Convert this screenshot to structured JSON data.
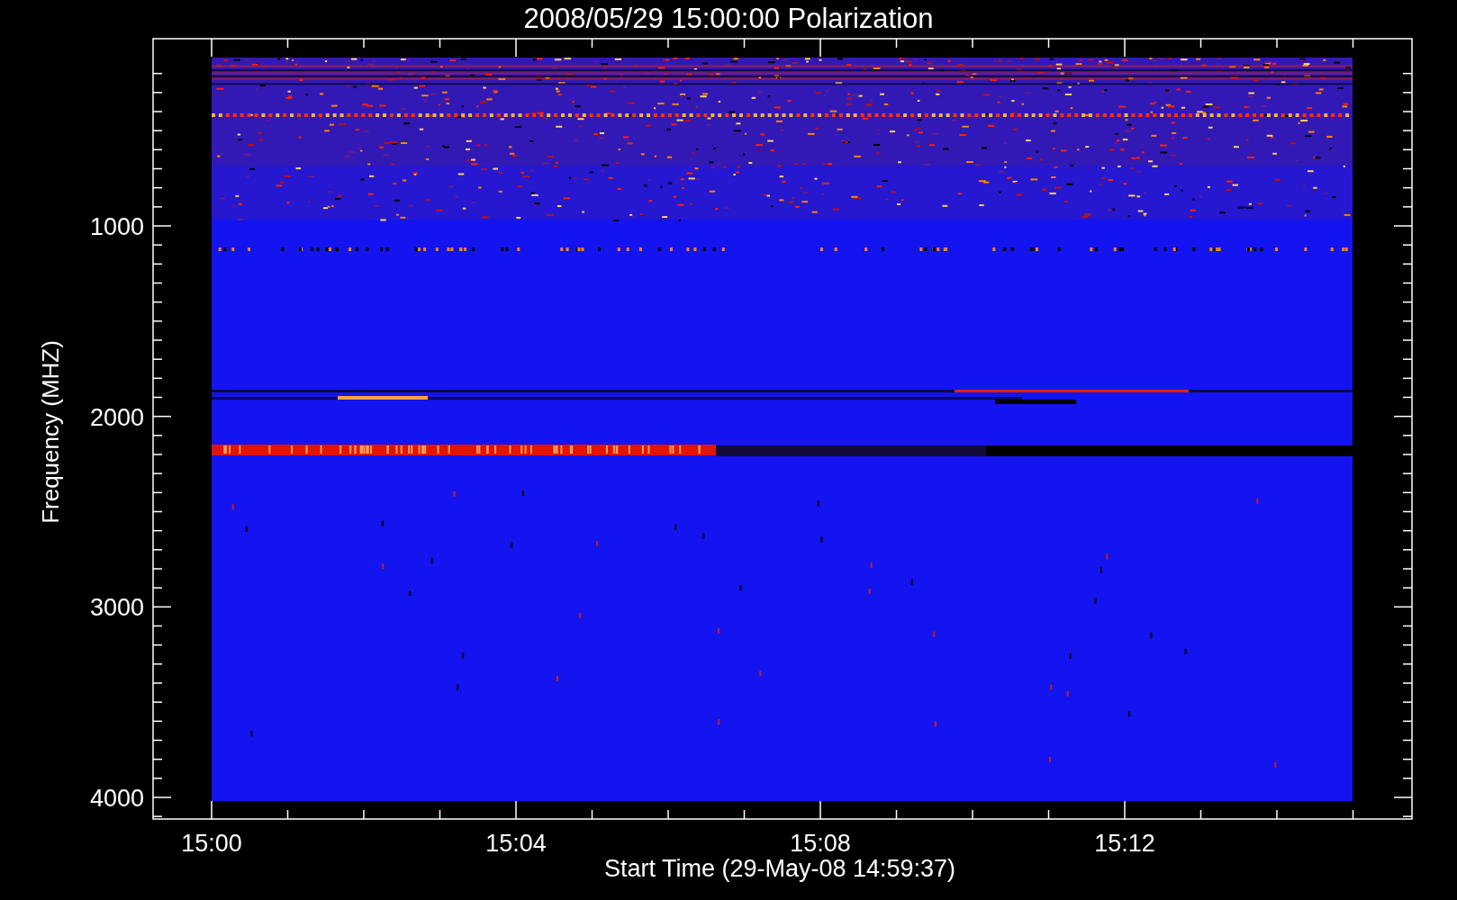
{
  "title": "2008/05/29 15:00:00 Polarization",
  "y_axis": {
    "label": "Frequency (MHZ)",
    "ticks": [
      "1000",
      "2000",
      "3000",
      "4000"
    ]
  },
  "x_axis": {
    "label": "Start Time (29-May-08 14:59:37)",
    "ticks": [
      "15:00",
      "15:04",
      "15:08",
      "15:12"
    ]
  }
}
